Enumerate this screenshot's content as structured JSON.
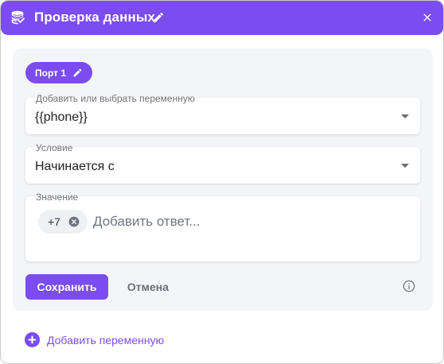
{
  "header": {
    "title": "Проверка данных",
    "icon": "database-check-icon",
    "edit_icon": "pencil-icon",
    "close_icon": "close-icon",
    "color": "#7b4cf0"
  },
  "port": {
    "label": "Порт 1",
    "edit_icon": "pencil-icon"
  },
  "variable_field": {
    "label": "Добавить или выбрать переменную",
    "value": "{{phone}}"
  },
  "condition_field": {
    "label": "Условие",
    "value": "Начинается с"
  },
  "value_field": {
    "label": "Значение",
    "tags": [
      "+7"
    ],
    "placeholder": "Добавить ответ..."
  },
  "actions": {
    "save_label": "Сохранить",
    "cancel_label": "Отмена",
    "info_icon": "info-icon"
  },
  "footer": {
    "add_variable_label": "Добавить переменную",
    "add_icon": "plus-circle-icon"
  }
}
